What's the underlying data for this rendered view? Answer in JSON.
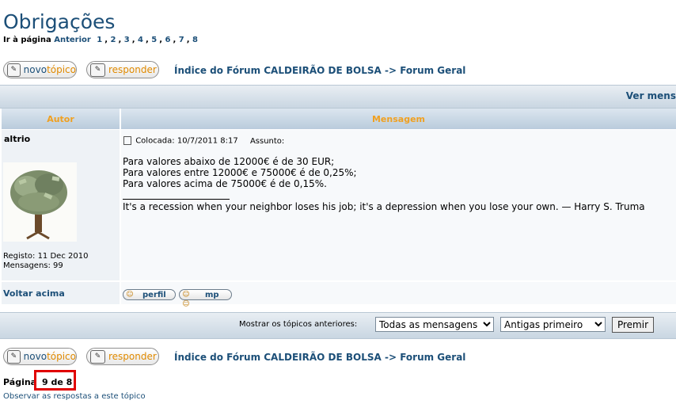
{
  "topic": {
    "title": "Obrigações"
  },
  "pagination": {
    "goto_label": "Ir à página",
    "previous": "Anterior",
    "pages": [
      "1",
      "2",
      "3",
      "4",
      "5",
      "6",
      "7",
      "8"
    ],
    "page_label": "Página",
    "page_value": "9 de 8"
  },
  "buttons": {
    "new_topic_a": "novo",
    "new_topic_b": "tópico",
    "reply": "responder",
    "profile": "perfil",
    "pm": "mp",
    "go": "Premir"
  },
  "breadcrumb": {
    "forum_index": "Índice do Fórum CALDEIRÃO DE BOLSA",
    "separator": "->",
    "forum": "Forum Geral"
  },
  "bar": {
    "view_messages": "Ver mens"
  },
  "table": {
    "col_author": "Autor",
    "col_message": "Mensagem"
  },
  "post": {
    "author": "altrio",
    "registered": "Registo: 11 Dec 2010",
    "messages": "Mensagens: 99",
    "posted": "Colocada: 10/7/2011 8:17",
    "subject_label": "Assunto:",
    "lines": [
      "Para valores abaixo de 12000€ é de 30 EUR;",
      "Para valores entre 12000€ e 75000€ é de 0,25%;",
      "Para valores acima de 75000€ é de 0,15%."
    ],
    "signature": "It's a recession when your neighbor loses his job; it's a depression when you lose your own. — Harry S. Truma"
  },
  "back_to_top": "Voltar acima",
  "filter": {
    "label": "Mostrar os tópicos anteriores:",
    "range_selected": "Todas as mensagens",
    "order_selected": "Antigas primeiro"
  },
  "watch_topic": "Observar as respostas a este tópico",
  "icons": [
    "document-icon",
    "post-icon",
    "profile-icon",
    "pm-icon",
    "tree-avatar"
  ],
  "colors": {
    "link": "#1c4f78",
    "header_text": "#f0a020",
    "highlight": "#e00000"
  }
}
